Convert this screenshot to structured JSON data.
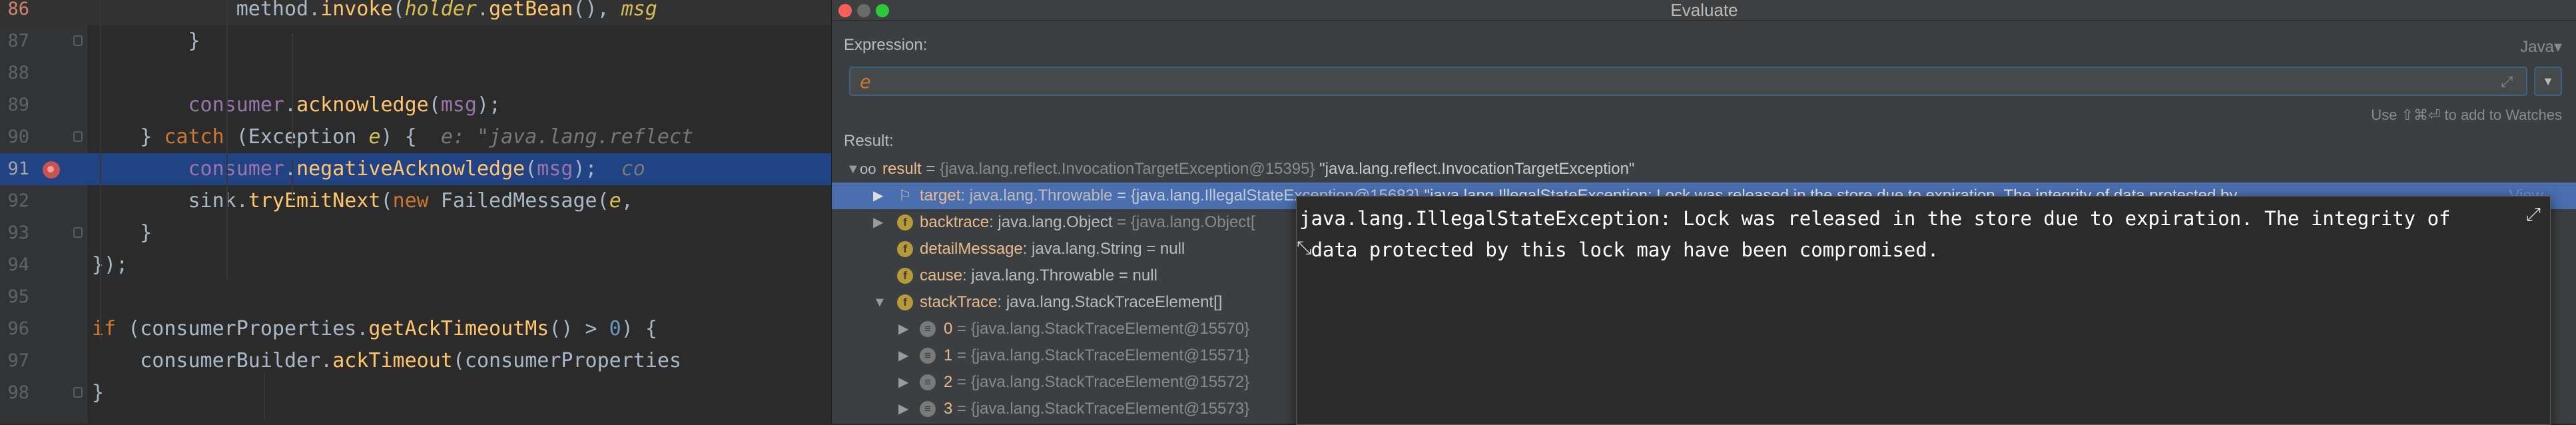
{
  "editor": {
    "lines": [
      {
        "num": "86",
        "html": "            <span class=\"cls\">method.</span><span class=\"fn\">invoke</span>(<span class=\"par\">holder</span>.<span class=\"fn\">getBean</span>(), <span class=\"par\">msg</span>"
      },
      {
        "num": "87",
        "html": "        }"
      },
      {
        "num": "88",
        "html": ""
      },
      {
        "num": "89",
        "html": "        <span class=\"fld\">consumer</span>.<span class=\"fn\">acknowledge</span>(<span class=\"fld\">msg</span>);"
      },
      {
        "num": "90",
        "html": "    } <span class=\"kw\">catch</span> (Exception <span class=\"par\">e</span>) {  <span class=\"hint\">e: \"java.lang.reflect</span>"
      },
      {
        "num": "91",
        "html": "        <span class=\"fld\">consumer</span>.<span class=\"fn\">negativeAcknowledge</span>(<span class=\"fld\">msg</span>);  <span class=\"hint\">co</span>"
      },
      {
        "num": "92",
        "html": "        sink.<span class=\"fn\">tryEmitNext</span>(<span class=\"kw\">new</span> FailedMessage(<span class=\"par\">e</span>,"
      },
      {
        "num": "93",
        "html": "    }"
      },
      {
        "num": "94",
        "html": "});"
      },
      {
        "num": "95",
        "html": ""
      },
      {
        "num": "96",
        "html": "<span class=\"kw\">if</span> (consumerProperties.<span class=\"fn\">getAckTimeoutMs</span>() > <span class=\"num\">0</span>) {"
      },
      {
        "num": "97",
        "html": "    consumerBuilder.<span class=\"fn\">ackTimeout</span>(consumerProperties"
      },
      {
        "num": "98",
        "html": "}"
      }
    ]
  },
  "dialog": {
    "title": "Evaluate",
    "expression_label": "Expression:",
    "language": "Java▾",
    "expression": "e",
    "watch_hint": "Use ⇧⌘⏎ to add to Watches",
    "result_label": "Result:"
  },
  "tree": {
    "root": {
      "name": "result",
      "eq": " = ",
      "value": "{java.lang.reflect.InvocationTargetException@15395}",
      "str": "\"java.lang.reflect.InvocationTargetException\""
    },
    "children": [
      {
        "name": "target",
        "type": ": java.lang.Throwable",
        "value": " = {java.lang.IllegalStateException@15683}",
        "str": " \"java.lang.IllegalStateException: Lock was released in the store due to expiration. The integrity of data protected by",
        "link": "View"
      },
      {
        "name": "backtrace",
        "type": ": java.lang.Object",
        "value": " = {java.lang.Object[",
        "str": ""
      },
      {
        "name": "detailMessage",
        "type": ": java.lang.String",
        "value": " = null",
        "str": ""
      },
      {
        "name": "cause",
        "type": ": java.lang.Throwable",
        "value": " = null",
        "str": ""
      },
      {
        "name": "stackTrace",
        "type": ": java.lang.StackTraceElement[]",
        "value": " =",
        "str": ""
      },
      {
        "name": "0",
        "type": "",
        "value": " = {java.lang.StackTraceElement@15570}",
        "str": ""
      },
      {
        "name": "1",
        "type": "",
        "value": " = {java.lang.StackTraceElement@15571}",
        "str": ""
      },
      {
        "name": "2",
        "type": "",
        "value": " = {java.lang.StackTraceElement@15572}",
        "str": ""
      },
      {
        "name": "3",
        "type": "",
        "value": " = {java.lang.StackTraceElement@15573}",
        "str": ""
      }
    ]
  },
  "popup": {
    "text": "java.lang.IllegalStateException: Lock was released in the store due to expiration. The integrity of\n data protected by this lock may have been compromised."
  }
}
